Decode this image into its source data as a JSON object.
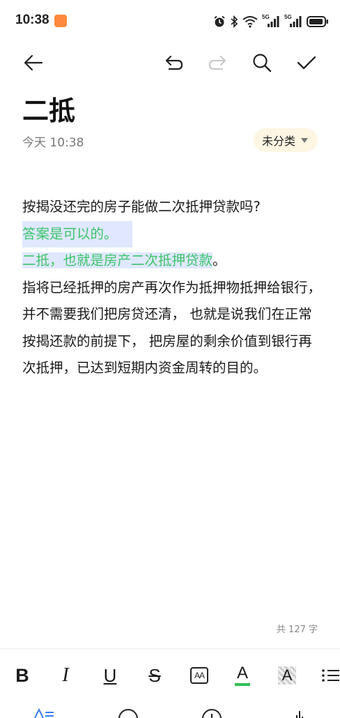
{
  "status_bar": {
    "time": "10:38",
    "signal_1_label": "5G",
    "signal_2_label": "5G"
  },
  "toolbar": {
    "back_icon": "arrow-left",
    "undo_icon": "undo",
    "redo_icon": "redo",
    "search_icon": "search",
    "done_icon": "check"
  },
  "note": {
    "title": "二抵",
    "meta": "今天 10:38",
    "category": "未分类",
    "lines": {
      "p1": "按揭没还完的房子能做二次抵押贷款吗?",
      "p2": "答案是可以的。",
      "p3_highlight": "二抵，也就是房产二次抵押贷款",
      "p3_rest": "。",
      "p4": "指将已经抵押的房产再次作为抵押物抵押给银行，并不需要我们把房贷还清， 也就是说我们在正常按揭还款的前提下， 把房屋的剩余价值到银行再次抵押，已达到短期内资金周转的目的。"
    },
    "word_count": "共 127 字"
  },
  "format_bar": {
    "bold": "B",
    "italic": "I",
    "underline": "U",
    "strike": "S",
    "text_size": "AA",
    "text_color": "A",
    "text_highlight": "A",
    "accent_color": "#2fbf55"
  }
}
